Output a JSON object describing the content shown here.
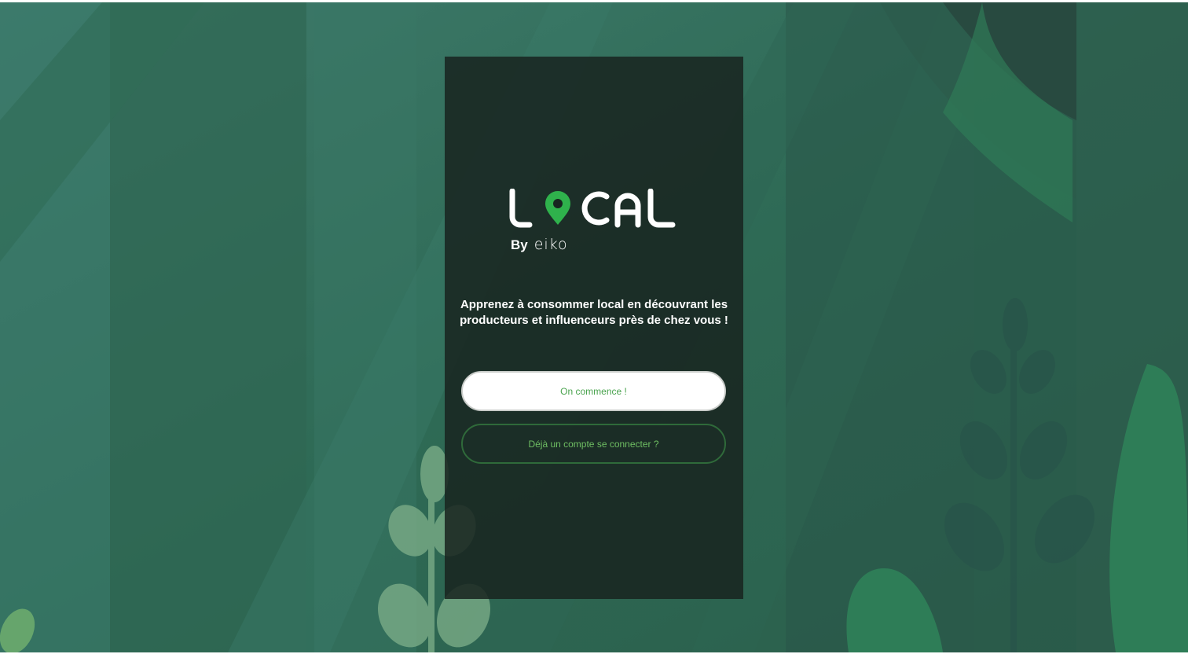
{
  "logo": {
    "wordmark": "LOCAL",
    "by_label": "By",
    "brand_label": "eiko"
  },
  "tagline": "Apprenez à consommer local en découvrant les producteurs et influenceurs près de chez vous !",
  "buttons": {
    "start_label": "On commence !",
    "login_label": "Déjà un compte se connecter ?"
  },
  "colors": {
    "accent_green": "#2fb24c",
    "panel": "#182420",
    "background": "#2f5e4b"
  }
}
